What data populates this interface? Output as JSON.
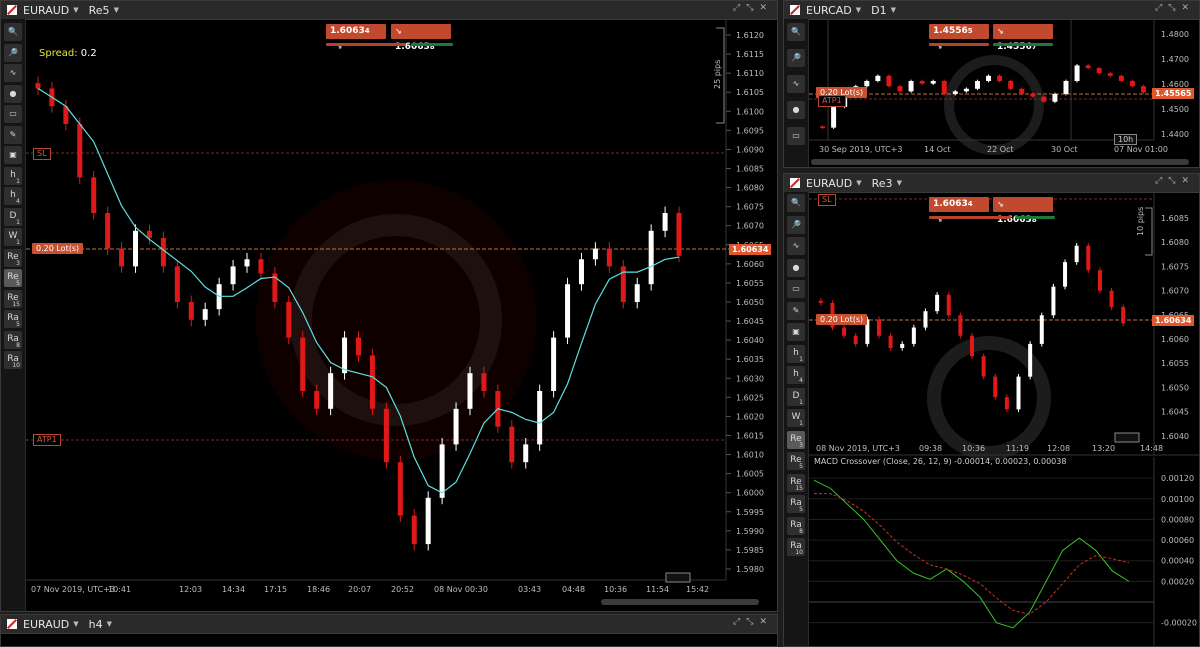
{
  "windows": {
    "main": {
      "symbol": "EURAUD",
      "timeframe": "Re5",
      "sell_price": "1.6063",
      "sell_small": "4",
      "buy_price": "1.6063",
      "buy_small": "8",
      "spread_label": "Spread:",
      "spread_value": "0.2",
      "pips_label": "25 pips",
      "sl_label": "SL",
      "atp_label": "ATP1",
      "lot_label": "0.20 Lot(s)",
      "current_price": "1.60634",
      "y_ticks": [
        "1.6120",
        "1.6115",
        "1.6110",
        "1.6105",
        "1.6100",
        "1.6095",
        "1.6090",
        "1.6085",
        "1.6080",
        "1.6075",
        "1.6070",
        "1.6065",
        "1.6060",
        "1.6055",
        "1.6050",
        "1.6045",
        "1.6040",
        "1.6035",
        "1.6030",
        "1.6025",
        "1.6020",
        "1.6015",
        "1.6010",
        "1.6005",
        "1.6000",
        "1.5995",
        "1.5990",
        "1.5985",
        "1.5980"
      ],
      "x_ticks": [
        "07 Nov 2019, UTC+3",
        "10:41",
        "12:03",
        "14:34",
        "17:15",
        "18:46",
        "20:07",
        "20:52",
        "08 Nov 00:30",
        "03:43",
        "04:48",
        "10:36",
        "11:54",
        "15:42"
      ]
    },
    "top_right": {
      "symbol": "EURCAD",
      "timeframe": "D1",
      "sell_price": "1.4556",
      "sell_small": "5",
      "buy_price": "1.4556",
      "buy_small": "7",
      "lot_label": "0.20 Lot(s)",
      "atp_label": "ATP1",
      "current_price": "1.45565",
      "y_ticks": [
        "1.4800",
        "1.4700",
        "1.4600",
        "1.4500",
        "1.4400"
      ],
      "x_ticks": [
        "30 Sep 2019, UTC+3",
        "14 Oct",
        "22 Oct",
        "30 Oct",
        "07 Nov 01:00"
      ],
      "marker": "10h"
    },
    "bottom_right": {
      "symbol": "EURAUD",
      "timeframe": "Re3",
      "sell_price": "1.6063",
      "sell_small": "4",
      "buy_price": "1.6063",
      "buy_small": "8",
      "sl_label": "SL",
      "lot_label": "0.20 Lot(s)",
      "pips_label": "10 pips",
      "current_price": "1.60634",
      "y_ticks": [
        "1.6085",
        "1.6080",
        "1.6075",
        "1.6070",
        "1.6065",
        "1.6060",
        "1.6055",
        "1.6050",
        "1.6045",
        "1.6040"
      ],
      "x_ticks": [
        "08 Nov 2019, UTC+3",
        "09:38",
        "10:36",
        "11:19",
        "12:08",
        "13:20",
        "14:48"
      ],
      "macd_label": "MACD Crossover (Close, 26, 12, 9) -0.00014, 0.00023, 0.00038",
      "macd_ticks": [
        "0.00120",
        "0.00100",
        "0.00080",
        "0.00060",
        "0.00040",
        "0.00020",
        "-0.00020"
      ]
    },
    "bottom_left": {
      "symbol": "EURAUD",
      "timeframe": "h4"
    }
  },
  "toolbar": {
    "buttons": [
      {
        "icon": "zoom-in-icon",
        "label": ""
      },
      {
        "icon": "zoom-out-icon",
        "label": ""
      },
      {
        "icon": "indicator-icon",
        "label": ""
      },
      {
        "icon": "cbot-icon",
        "label": ""
      },
      {
        "icon": "chart-type-icon",
        "label": ""
      },
      {
        "icon": "drawing-icon",
        "label": ""
      },
      {
        "icon": "screenshot-icon",
        "label": ""
      },
      {
        "icon": "timeframe-h1",
        "label": "h",
        "sub": "1"
      },
      {
        "icon": "timeframe-h4",
        "label": "h",
        "sub": "4"
      },
      {
        "icon": "timeframe-d1",
        "label": "D",
        "sub": "1"
      },
      {
        "icon": "timeframe-w1",
        "label": "W",
        "sub": "1"
      },
      {
        "icon": "timeframe-re3",
        "label": "Re",
        "sub": "3"
      },
      {
        "icon": "timeframe-re5",
        "label": "Re",
        "sub": "5"
      },
      {
        "icon": "timeframe-re15",
        "label": "Re",
        "sub": "15"
      },
      {
        "icon": "timeframe-ra5",
        "label": "Ra",
        "sub": "5"
      },
      {
        "icon": "timeframe-ra8",
        "label": "Ra",
        "sub": "8"
      },
      {
        "icon": "timeframe-ra10",
        "label": "Ra",
        "sub": "10"
      }
    ]
  },
  "chart_data": [
    {
      "type": "candlestick",
      "title": "EURAUD Re5",
      "ylim": [
        1.5975,
        1.6125
      ],
      "series_close_approx": [
        1.611,
        1.6105,
        1.61,
        1.6085,
        1.6075,
        1.6065,
        1.606,
        1.607,
        1.6068,
        1.606,
        1.605,
        1.6045,
        1.6048,
        1.6055,
        1.606,
        1.6062,
        1.6058,
        1.605,
        1.604,
        1.6025,
        1.602,
        1.603,
        1.604,
        1.6035,
        1.602,
        1.6005,
        1.599,
        1.5982,
        1.5995,
        1.601,
        1.602,
        1.603,
        1.6025,
        1.6015,
        1.6005,
        1.601,
        1.6025,
        1.604,
        1.6055,
        1.6062,
        1.6065,
        1.606,
        1.605,
        1.6055,
        1.607,
        1.6075,
        1.6063
      ],
      "moving_average": "cyan"
    },
    {
      "type": "candlestick",
      "title": "EURCAD D1",
      "ylim": [
        1.438,
        1.482
      ],
      "series_close_approx": [
        1.442,
        1.45,
        1.454,
        1.458,
        1.46,
        1.462,
        1.458,
        1.456,
        1.46,
        1.459,
        1.46,
        1.455,
        1.456,
        1.457,
        1.46,
        1.462,
        1.46,
        1.457,
        1.455,
        1.454,
        1.452,
        1.455,
        1.46,
        1.466,
        1.465,
        1.463,
        1.462,
        1.46,
        1.458,
        1.4556
      ]
    },
    {
      "type": "candlestick",
      "title": "EURAUD Re3",
      "ylim": [
        1.6035,
        1.609
      ],
      "series_close_approx": [
        1.6068,
        1.6062,
        1.606,
        1.6058,
        1.6064,
        1.606,
        1.6057,
        1.6058,
        1.6062,
        1.6066,
        1.607,
        1.6065,
        1.606,
        1.6055,
        1.605,
        1.6045,
        1.6042,
        1.605,
        1.6058,
        1.6065,
        1.6072,
        1.6078,
        1.6082,
        1.6076,
        1.6071,
        1.6067,
        1.6063
      ]
    },
    {
      "type": "line",
      "title": "MACD Crossover (Close, 26, 12, 9)",
      "ylim": [
        -0.0003,
        0.00125
      ],
      "series": [
        {
          "name": "macd",
          "color": "#38c425",
          "values": [
            0.00118,
            0.0011,
            0.00095,
            0.0008,
            0.0006,
            0.0004,
            0.00028,
            0.00022,
            0.00032,
            0.0002,
            5e-05,
            -0.0002,
            -0.00025,
            -0.0001,
            0.0002,
            0.0005,
            0.00062,
            0.0005,
            0.0003,
            0.0002
          ]
        },
        {
          "name": "signal",
          "color": "#c83223",
          "values": [
            0.00105,
            0.00105,
            0.00098,
            0.00088,
            0.00074,
            0.00058,
            0.00046,
            0.00036,
            0.00032,
            0.00026,
            0.00018,
            4e-05,
            -8e-05,
            -0.00012,
            0.0,
            0.00018,
            0.00036,
            0.00045,
            0.00042,
            0.00038
          ]
        }
      ]
    }
  ]
}
